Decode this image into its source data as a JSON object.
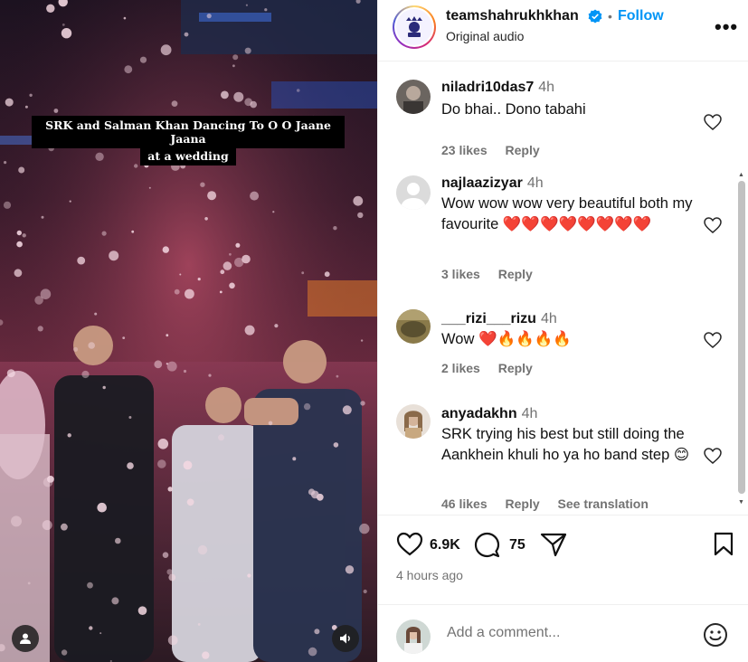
{
  "media": {
    "caption_line1": "SRK and Salman Khan Dancing To O O Jaane Jaana",
    "caption_line2": "at a wedding",
    "user_tag_icon": "user-icon",
    "volume_icon": "volume-icon"
  },
  "header": {
    "username": "teamshahrukhkhan",
    "separator": "•",
    "follow_label": "Follow",
    "audio_label": "Original audio",
    "more_label": "•••"
  },
  "comments": [
    {
      "username": "niladri10das7",
      "time": "4h",
      "text": "Do bhai.. Dono tabahi",
      "likes": "23 likes",
      "reply": "Reply",
      "translate": ""
    },
    {
      "username": "najlaazizyar",
      "time": "4h",
      "text": "Wow wow wow very beautiful both my favourite ❤️❤️❤️❤️❤️❤️❤️❤️",
      "likes": "3 likes",
      "reply": "Reply",
      "translate": ""
    },
    {
      "username": "___rizi___rizu",
      "time": "4h",
      "text": "Wow ❤️🔥🔥🔥🔥",
      "likes": "2 likes",
      "reply": "Reply",
      "translate": ""
    },
    {
      "username": "anyadakhn",
      "time": "4h",
      "text": "SRK trying his best but still doing the Aankhein khuli ho ya ho band step 😊",
      "likes": "46 likes",
      "reply": "Reply",
      "translate": "See translation"
    }
  ],
  "actions": {
    "like_count": "6.9K",
    "comment_count": "75",
    "time_ago": "4 hours ago"
  },
  "add_comment": {
    "placeholder": "Add a comment..."
  },
  "colors": {
    "accent": "#0095f6",
    "verified": "#0095f6",
    "heart": "#e0202b"
  }
}
